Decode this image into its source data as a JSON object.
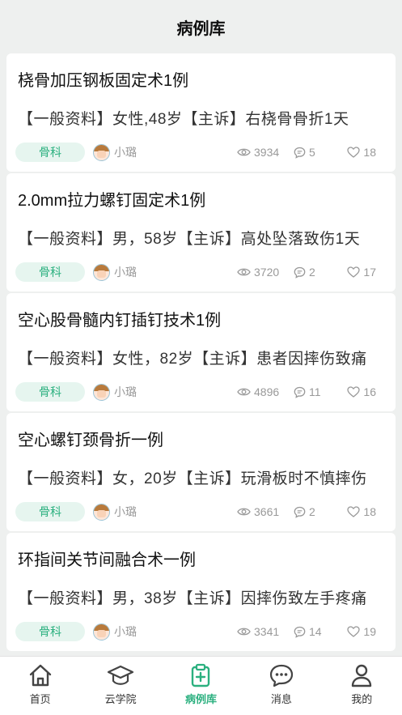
{
  "header": {
    "title": "病例库"
  },
  "cases": [
    {
      "title": "桡骨加压钢板固定术1例",
      "summary": "【一般资料】女性,48岁【主诉】右桡骨骨折1天",
      "tag": "骨科",
      "author": "小璐",
      "views": "3934",
      "comments": "5",
      "likes": "18"
    },
    {
      "title": "2.0mm拉力螺钉固定术1例",
      "summary": "【一般资料】男，58岁【主诉】高处坠落致伤1天",
      "tag": "骨科",
      "author": "小璐",
      "views": "3720",
      "comments": "2",
      "likes": "17"
    },
    {
      "title": "空心股骨髓内钉插钉技术1例",
      "summary": "【一般资料】女性，82岁【主诉】患者因摔伤致痛",
      "tag": "骨科",
      "author": "小璐",
      "views": "4896",
      "comments": "11",
      "likes": "16"
    },
    {
      "title": "空心螺钉颈骨折一例",
      "summary": "【一般资料】女，20岁【主诉】玩滑板时不慎摔伤",
      "tag": "骨科",
      "author": "小璐",
      "views": "3661",
      "comments": "2",
      "likes": "18"
    },
    {
      "title": "环指间关节间融合术一例",
      "summary": "【一般资料】男，38岁【主诉】因摔伤致左手疼痛",
      "tag": "骨科",
      "author": "小璐",
      "views": "3341",
      "comments": "14",
      "likes": "19"
    }
  ],
  "tabbar": {
    "accent": "#2bb07f",
    "items": [
      {
        "label": "首页",
        "icon": "home-icon"
      },
      {
        "label": "云学院",
        "icon": "graduation-cap-icon"
      },
      {
        "label": "病例库",
        "icon": "clipboard-plus-icon",
        "active": true
      },
      {
        "label": "消息",
        "icon": "chat-bubble-icon"
      },
      {
        "label": "我的",
        "icon": "user-icon"
      }
    ]
  }
}
